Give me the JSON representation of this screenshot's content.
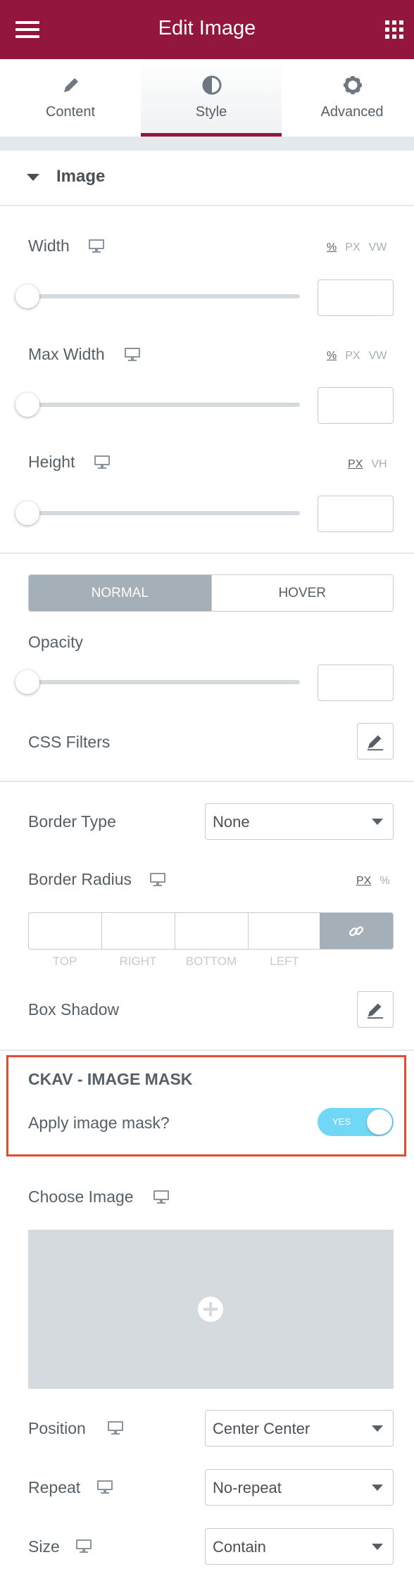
{
  "header": {
    "title": "Edit Image"
  },
  "tabs": [
    {
      "label": "Content"
    },
    {
      "label": "Style"
    },
    {
      "label": "Advanced"
    }
  ],
  "section": {
    "title": "Image"
  },
  "width": {
    "label": "Width",
    "units": [
      "%",
      "PX",
      "VW"
    ],
    "value": ""
  },
  "max_width": {
    "label": "Max Width",
    "units": [
      "%",
      "PX",
      "VW"
    ],
    "value": ""
  },
  "height": {
    "label": "Height",
    "units": [
      "PX",
      "VH"
    ],
    "value": ""
  },
  "state_tabs": {
    "normal": "NORMAL",
    "hover": "HOVER"
  },
  "opacity": {
    "label": "Opacity",
    "value": ""
  },
  "css_filters": {
    "label": "CSS Filters"
  },
  "border_type": {
    "label": "Border Type",
    "value": "None"
  },
  "border_radius": {
    "label": "Border Radius",
    "units": [
      "PX",
      "%"
    ],
    "dims": [
      "TOP",
      "RIGHT",
      "BOTTOM",
      "LEFT"
    ]
  },
  "box_shadow": {
    "label": "Box Shadow"
  },
  "ckav": {
    "title": "CKAV - IMAGE MASK",
    "apply_label": "Apply image mask?",
    "toggle_text": "YES"
  },
  "choose_image": {
    "label": "Choose Image"
  },
  "position": {
    "label": "Position",
    "value": "Center Center"
  },
  "repeat": {
    "label": "Repeat",
    "value": "No-repeat"
  },
  "size": {
    "label": "Size",
    "value": "Contain"
  },
  "colors": {
    "header": "#93173d",
    "toggle": "#71d7f7",
    "highlight": "#e34b33"
  }
}
